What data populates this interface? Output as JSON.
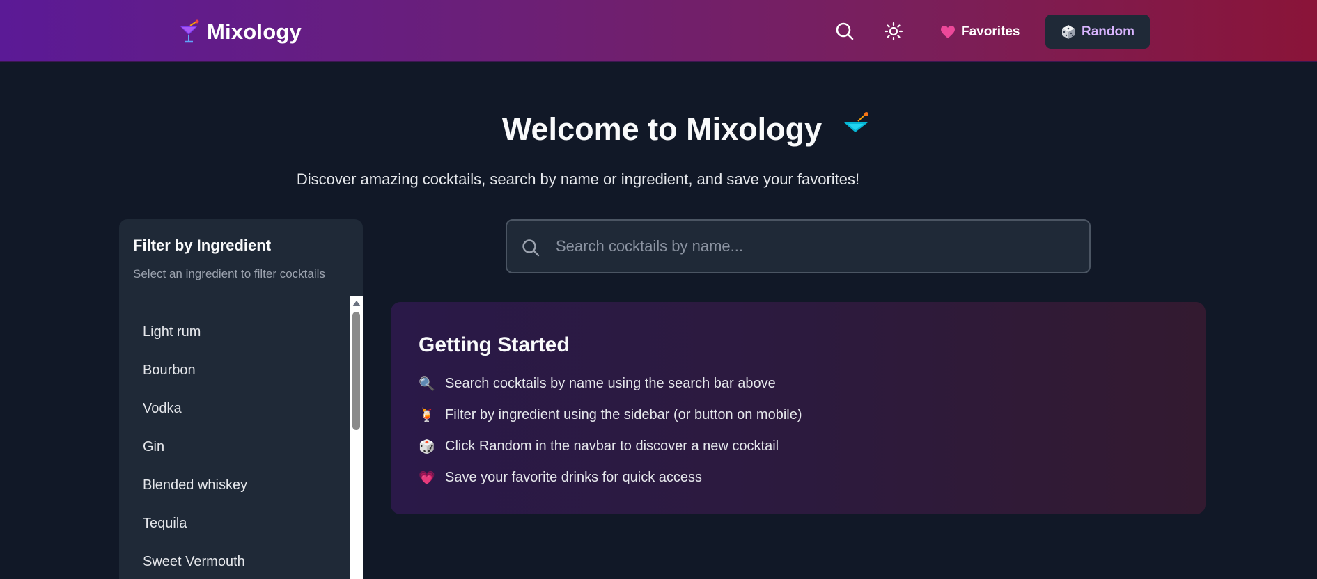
{
  "navbar": {
    "brand": "Mixology",
    "brand_icon": "cocktail-icon",
    "search_icon": "search-icon",
    "theme_icon": "sun-icon",
    "favorites_label": "Favorites",
    "favorites_icon": "heart-icon",
    "random_label": "Random",
    "random_icon": "dice-icon"
  },
  "hero": {
    "title": "Welcome to Mixology",
    "title_icon": "cocktail-glass-icon",
    "subtitle": "Discover amazing cocktails, search by name or ingredient, and save your favorites!"
  },
  "sidebar": {
    "title": "Filter by Ingredient",
    "subtitle": "Select an ingredient to filter cocktails",
    "ingredients": [
      "Light rum",
      "Bourbon",
      "Vodka",
      "Gin",
      "Blended whiskey",
      "Tequila",
      "Sweet Vermouth"
    ]
  },
  "search": {
    "placeholder": "Search cocktails by name...",
    "value": ""
  },
  "getting_started": {
    "title": "Getting Started",
    "tips": [
      {
        "icon": "magnifier-icon",
        "glyph": "🔍",
        "text": "Search cocktails by name using the search bar above"
      },
      {
        "icon": "tropical-drink-icon",
        "glyph": "🍹",
        "text": "Filter by ingredient using the sidebar (or button on mobile)"
      },
      {
        "icon": "dice-icon",
        "glyph": "🎲",
        "text": "Click Random in the navbar to discover a new cocktail"
      },
      {
        "icon": "heart-icon",
        "glyph": "💗",
        "text": "Save your favorite drinks for quick access"
      }
    ]
  },
  "colors": {
    "background": "#111827",
    "navbar_start": "#5b1a96",
    "navbar_end": "#8a1438",
    "panel": "#1f2937",
    "random_text": "#d8b4fe",
    "heart": "#ec4899"
  }
}
